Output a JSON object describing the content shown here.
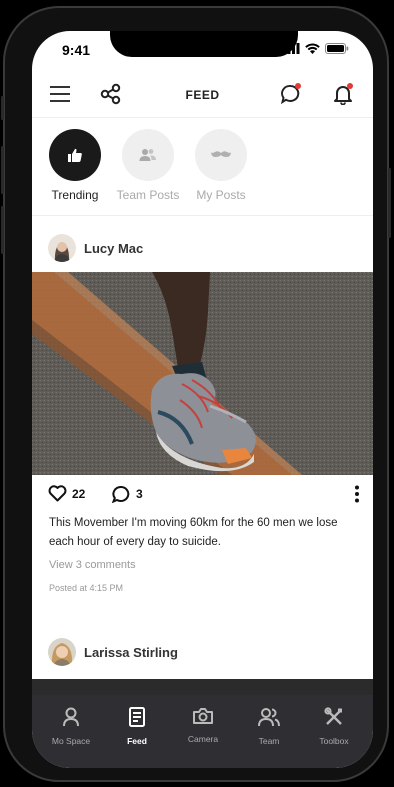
{
  "status": {
    "time": "9:41"
  },
  "header": {
    "title": "FEED"
  },
  "stories": [
    {
      "label": "Trending",
      "icon": "thumbs-up-icon",
      "active": true
    },
    {
      "label": "Team Posts",
      "icon": "team-icon",
      "active": false
    },
    {
      "label": "My Posts",
      "icon": "moustache-icon",
      "active": false
    }
  ],
  "post1": {
    "author": "Lucy Mac",
    "likes": "22",
    "comments": "3",
    "caption": "This Movember I'm moving 60km  for the 60 men we lose each hour of every day to suicide.",
    "view_comments": "View 3 comments",
    "posted": "Posted at 4:15 PM"
  },
  "post2": {
    "author": "Larissa Stirling"
  },
  "tabs": [
    {
      "label": "Mo Space",
      "icon": "person-icon",
      "active": false
    },
    {
      "label": "Feed",
      "icon": "document-icon",
      "active": true
    },
    {
      "label": "Camera",
      "icon": "camera-icon",
      "active": false
    },
    {
      "label": "Team",
      "icon": "team-icon",
      "active": false
    },
    {
      "label": "Toolbox",
      "icon": "tools-icon",
      "active": false
    }
  ],
  "colors": {
    "accent_red": "#e53935",
    "tabbar": "#2f2f33",
    "dark_circle": "#1a1a1a"
  }
}
